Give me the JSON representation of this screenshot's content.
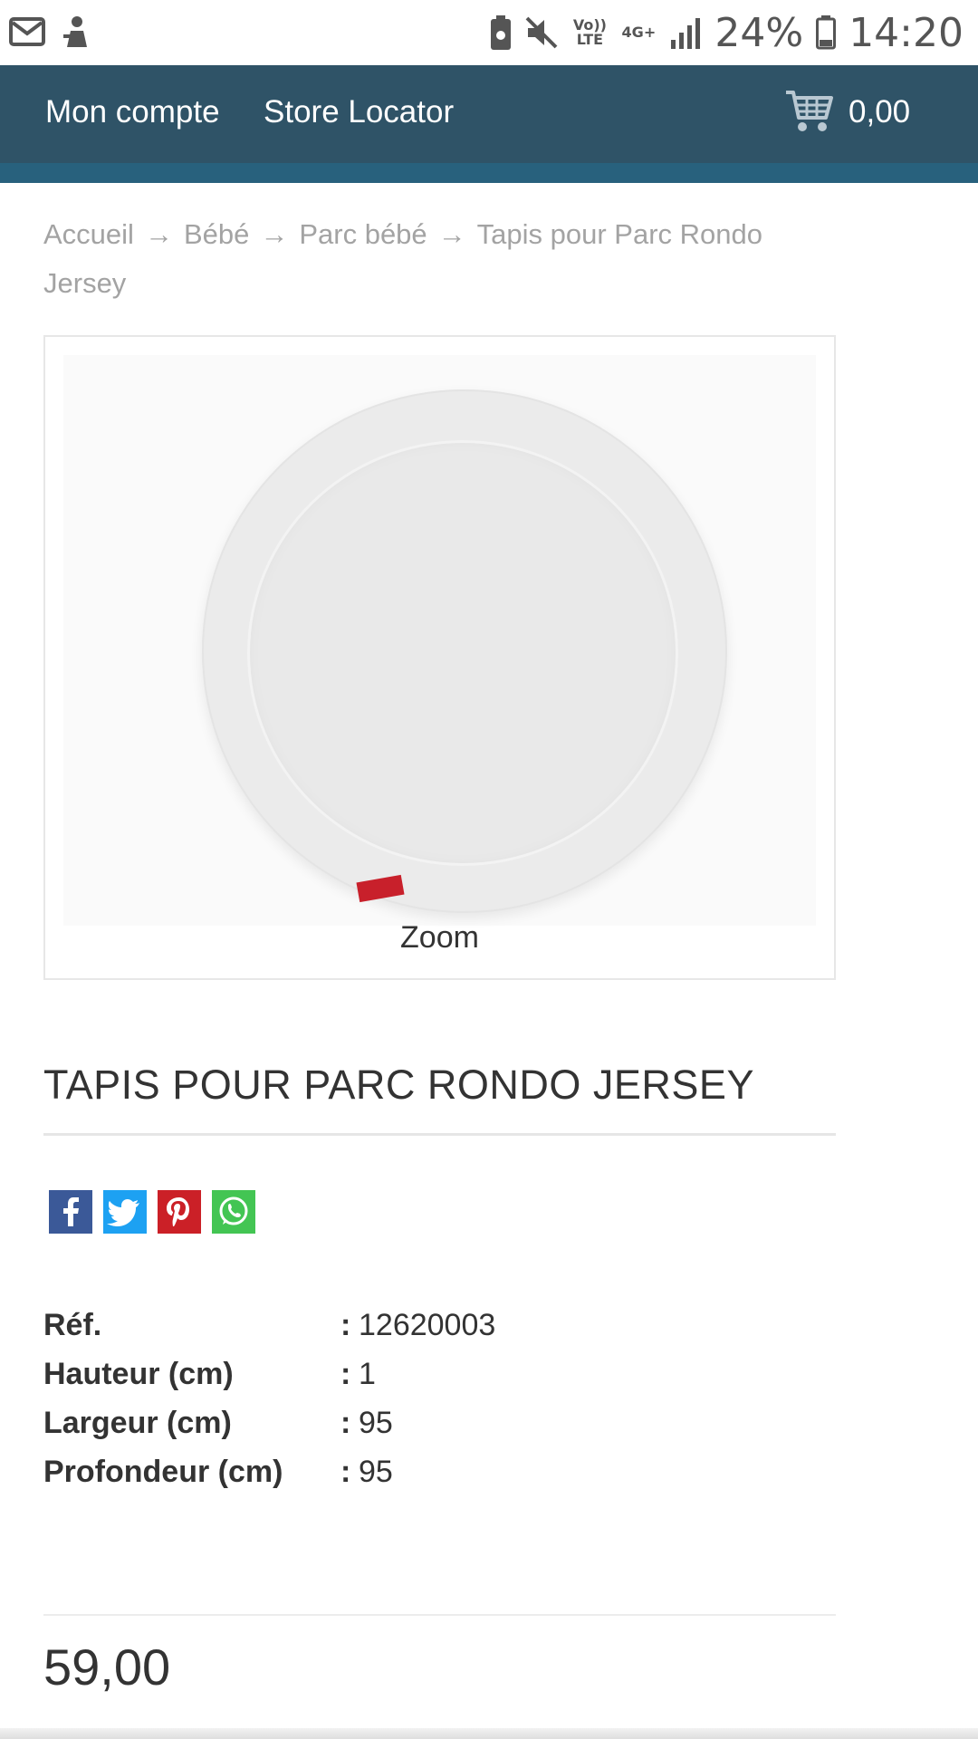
{
  "status_bar": {
    "battery_percent": "24%",
    "time": "14:20",
    "network_volte": "Vo)) LTE",
    "network_type": "4G+",
    "icons": [
      "mail-icon",
      "cleaner-icon",
      "battery-saver-icon",
      "mute-icon",
      "volte-icon",
      "network-4g-icon",
      "signal-icon",
      "battery-icon"
    ]
  },
  "nav": {
    "account_label": "Mon compte",
    "store_locator_label": "Store Locator",
    "cart_total": "0,00",
    "bg_color": "#2f5367"
  },
  "breadcrumb": {
    "items": [
      "Accueil",
      "Bébé",
      "Parc bébé",
      "Tapis pour Parc Rondo Jersey"
    ],
    "separator": "→"
  },
  "product": {
    "zoom_label": "Zoom",
    "title": "TAPIS POUR PARC RONDO JERSEY",
    "share": [
      "facebook-icon",
      "twitter-icon",
      "pinterest-icon",
      "whatsapp-icon"
    ],
    "specs": [
      {
        "label": "Réf.",
        "value": "12620003"
      },
      {
        "label": "Hauteur (cm)",
        "value": "1"
      },
      {
        "label": "Largeur (cm)",
        "value": "95"
      },
      {
        "label": "Profondeur (cm)",
        "value": "95"
      }
    ],
    "colon": ":",
    "price": "59,00"
  }
}
